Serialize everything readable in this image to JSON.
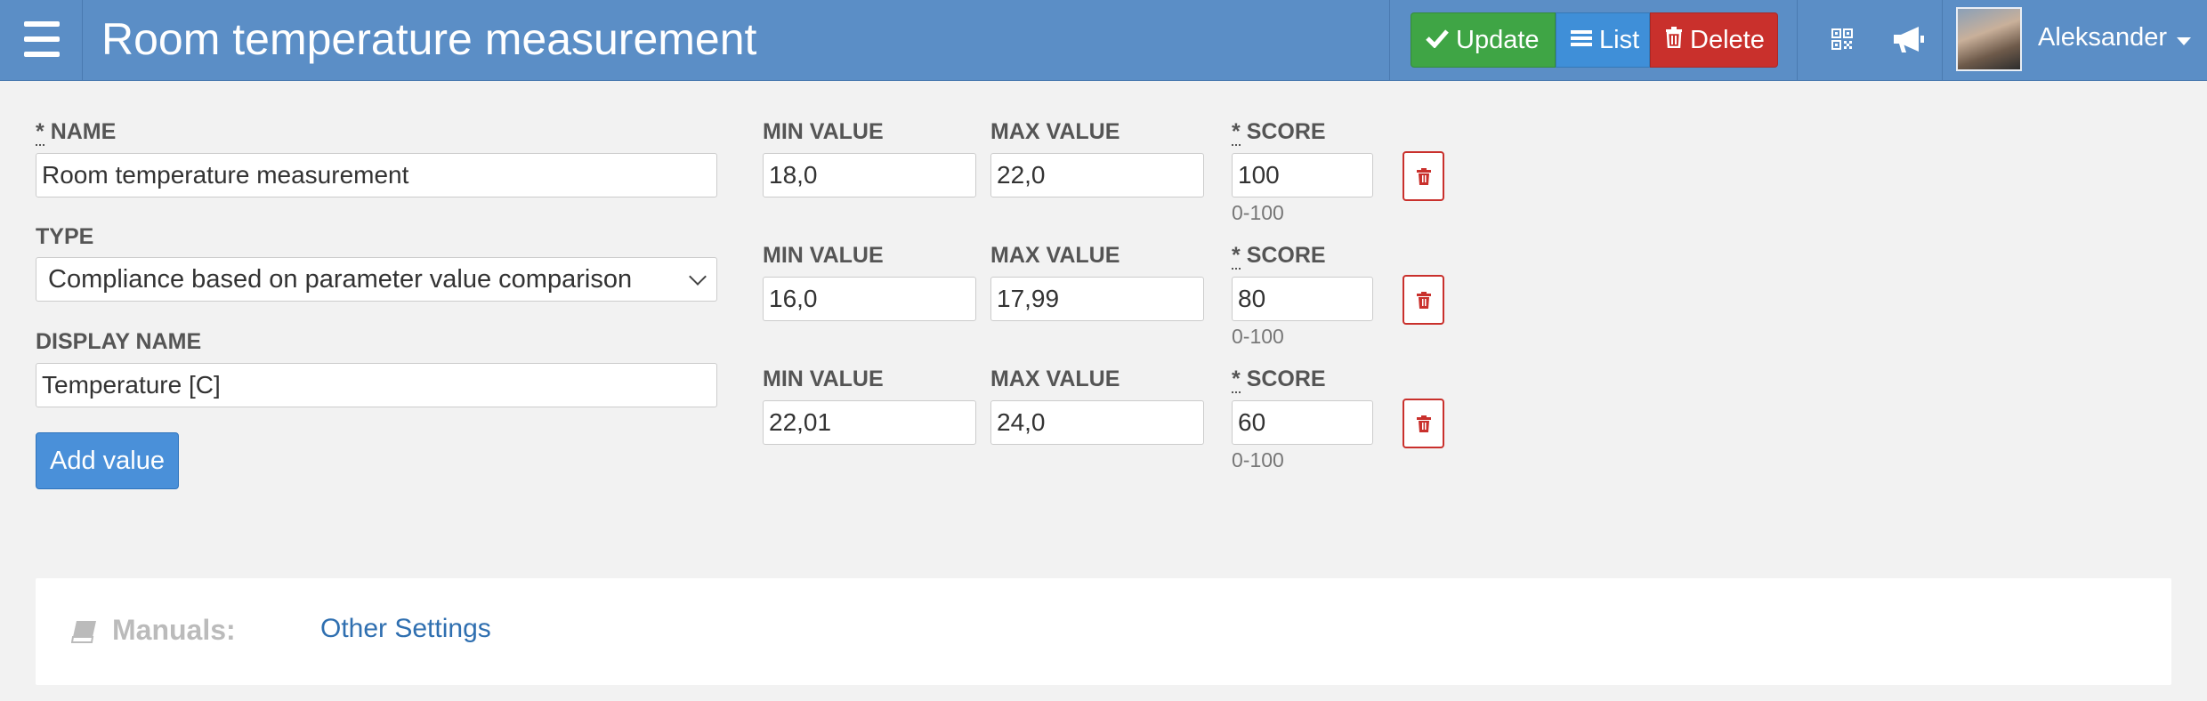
{
  "header": {
    "title": "Room temperature measurement",
    "buttons": {
      "update": "Update",
      "list": "List",
      "delete": "Delete"
    },
    "user": "Aleksander",
    "icons": [
      "menu-icon",
      "qr-code-icon",
      "megaphone-icon",
      "check-icon",
      "list-icon",
      "trash-icon",
      "caret-down-icon"
    ]
  },
  "form": {
    "name": {
      "label_req": "*",
      "label": "NAME",
      "value": "Room temperature measurement"
    },
    "type": {
      "label": "TYPE",
      "selected": "Compliance based on parameter value comparison"
    },
    "display_name": {
      "label": "DISPLAY NAME",
      "value": "Temperature [C]"
    },
    "add_value": "Add value"
  },
  "values": {
    "min_label": "MIN VALUE",
    "max_label": "MAX VALUE",
    "score_req": "*",
    "score_label": "SCORE",
    "score_hint": "0-100",
    "rows": [
      {
        "min": "18,0",
        "max": "22,0",
        "score": "100"
      },
      {
        "min": "16,0",
        "max": "17,99",
        "score": "80"
      },
      {
        "min": "22,01",
        "max": "24,0",
        "score": "60"
      }
    ]
  },
  "manuals": {
    "label": "Manuals:",
    "link": "Other Settings"
  },
  "colors": {
    "header": "#5b8ec6",
    "update": "#3fa545",
    "list": "#3f8fd8",
    "delete": "#c9302c",
    "link": "#2f6fb0"
  }
}
